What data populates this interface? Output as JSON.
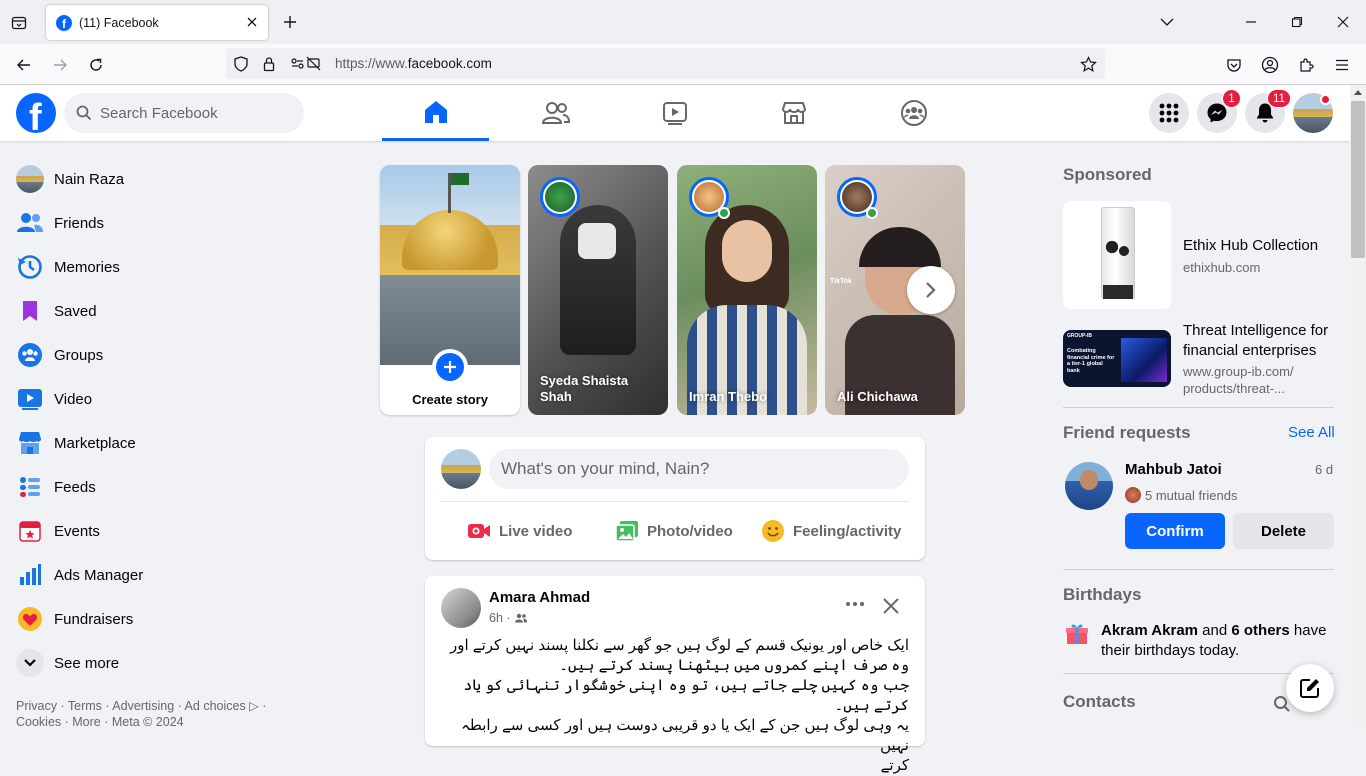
{
  "browser": {
    "tab_title": "(11) Facebook",
    "url_prefix": "https://www.",
    "url_domain": "facebook.com"
  },
  "header": {
    "search_placeholder": "Search Facebook",
    "messenger_badge": "1",
    "notifications_badge": "11",
    "logo_letter": "f"
  },
  "sidebar": {
    "items": [
      {
        "label": "Nain Raza",
        "icon": "profile-avatar"
      },
      {
        "label": "Friends",
        "icon": "friends-icon"
      },
      {
        "label": "Memories",
        "icon": "memories-icon"
      },
      {
        "label": "Saved",
        "icon": "saved-icon"
      },
      {
        "label": "Groups",
        "icon": "groups-icon"
      },
      {
        "label": "Video",
        "icon": "video-icon"
      },
      {
        "label": "Marketplace",
        "icon": "marketplace-icon"
      },
      {
        "label": "Feeds",
        "icon": "feeds-icon"
      },
      {
        "label": "Events",
        "icon": "events-icon"
      },
      {
        "label": "Ads Manager",
        "icon": "ads-manager-icon"
      },
      {
        "label": "Fundraisers",
        "icon": "fundraisers-icon"
      },
      {
        "label": "See more",
        "icon": "chevron-down-icon"
      }
    ],
    "footer_line1": "Privacy · Terms · Advertising · Ad choices ▷ ·",
    "footer_line2": "Cookies · More · Meta © 2024"
  },
  "stories": {
    "create_label": "Create story",
    "items": [
      {
        "name": "Syeda Shaista Shah"
      },
      {
        "name": "Imran Thebo"
      },
      {
        "name": "Ali Chichawa"
      }
    ],
    "tiktok_watermark": "TikTok"
  },
  "composer": {
    "placeholder": "What's on your mind, Nain?",
    "live_video": "Live video",
    "photo_video": "Photo/video",
    "feeling": "Feeling/activity"
  },
  "post": {
    "author": "Amara Ahmad",
    "time": "6h ·",
    "text_lines": [
      "ایک خاص اور یونیک قسم کے لوگ ہیں جو گھر سے نکلنا پسند نہیں کرتے اور",
      "وہ صرف اپنے کمروں میں بیٹھنا پسند کرتے ہیں۔",
      "جب وہ کہیں چلے جاتے ہیں، تو وہ اپنی خوشگوار تنہائی کو یاد کرتے ہیں۔",
      "یہ وہی لوگ ہیں جن کے ایک یا دو قریبی دوست ہیں اور کسی سے رابطہ نہیں",
      "کرتے"
    ]
  },
  "right": {
    "sponsored_title": "Sponsored",
    "ads": [
      {
        "name": "Ethix Hub Collection",
        "url": "ethixhub.com"
      },
      {
        "name_line1": "Threat Intelligence for",
        "name_line2": "financial enterprises",
        "url_line1": "www.group-ib.com/",
        "url_line2": "products/threat-..."
      }
    ],
    "ad2_image_text": "Combating financial crime for a tier-1 global bank",
    "ad2_logo_text": "GROUP-IB",
    "friend_requests_title": "Friend requests",
    "see_all": "See All",
    "request": {
      "name": "Mahbub Jatoi",
      "age": "6 d",
      "mutual": "5 mutual friends",
      "confirm": "Confirm",
      "delete": "Delete"
    },
    "birthdays_title": "Birthdays",
    "birthday_name": "Akram Akram",
    "birthday_rest1": " and ",
    "birthday_others": "6 others",
    "birthday_rest2": " have",
    "birthday_line2": "their birthdays today.",
    "contacts_title": "Contacts"
  },
  "colors": {
    "brand": "#0866ff",
    "badge": "#e41e3f",
    "background": "#f0f2f5"
  }
}
